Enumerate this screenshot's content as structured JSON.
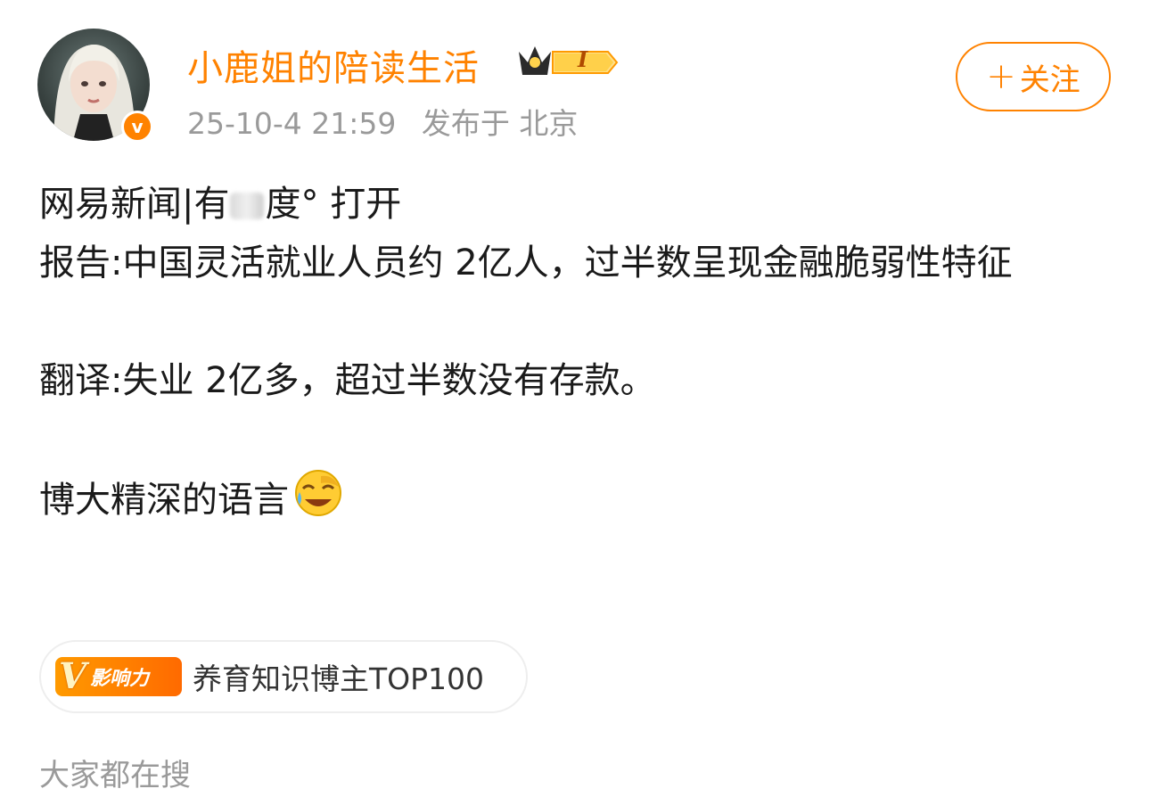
{
  "post": {
    "author": "小鹿姐的陪读生活",
    "level_badge": "I",
    "timestamp": "25-10-4 21:59",
    "location": "发布于 北京",
    "follow_label": "关注",
    "follow_plus": "+",
    "lines": {
      "source_prefix": "网易新闻|有",
      "source_suffix": "度° 打开",
      "headline": "报告:中国灵活就业人员约 2亿人，过半数呈现金融脆弱性特征",
      "translation": "翻译:失业 2亿多，超过半数没有存款。",
      "comment": "博大精深的语言"
    },
    "influence_badge": {
      "label": "影响力",
      "text": "养育知识博主TOP100"
    }
  },
  "footer": {
    "search_hint": "大家都在搜"
  },
  "colors": {
    "accent": "#ff8200",
    "meta": "#9a9a9a"
  }
}
